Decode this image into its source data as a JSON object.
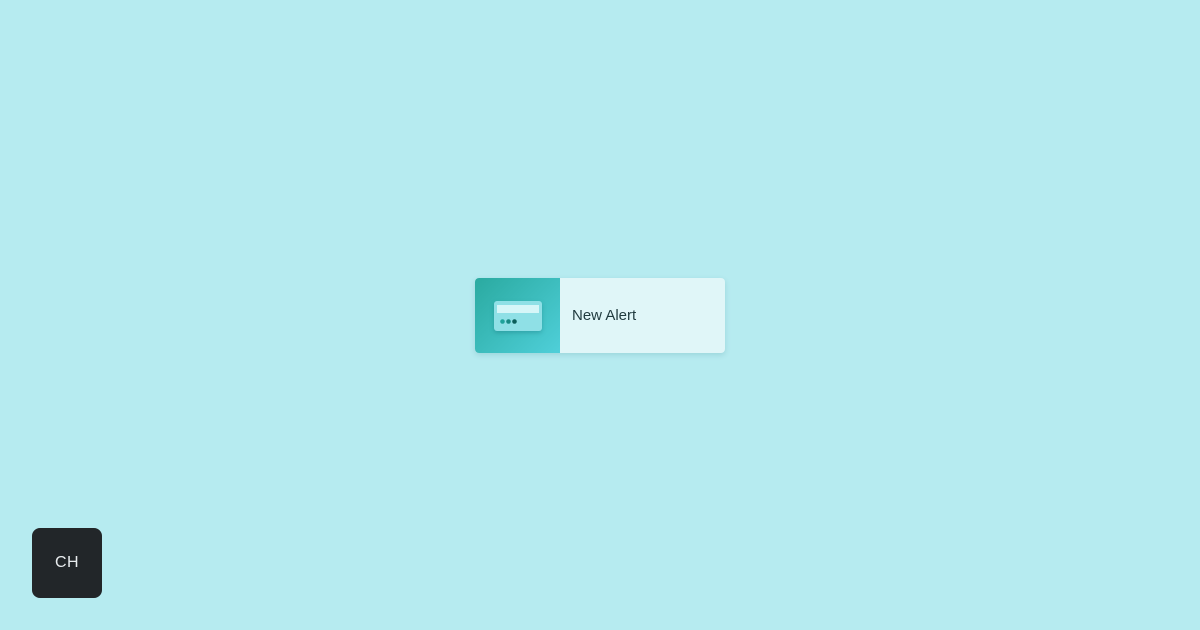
{
  "alert": {
    "label": "New Alert",
    "icon": "credit-card-icon"
  },
  "avatar": {
    "initials": "CH"
  },
  "colors": {
    "background": "#b6ebf0",
    "card_background": "#e0f6f8",
    "thumb_gradient_start": "#2aaaa0",
    "thumb_gradient_end": "#4fcfd9",
    "avatar_background": "#222629"
  }
}
